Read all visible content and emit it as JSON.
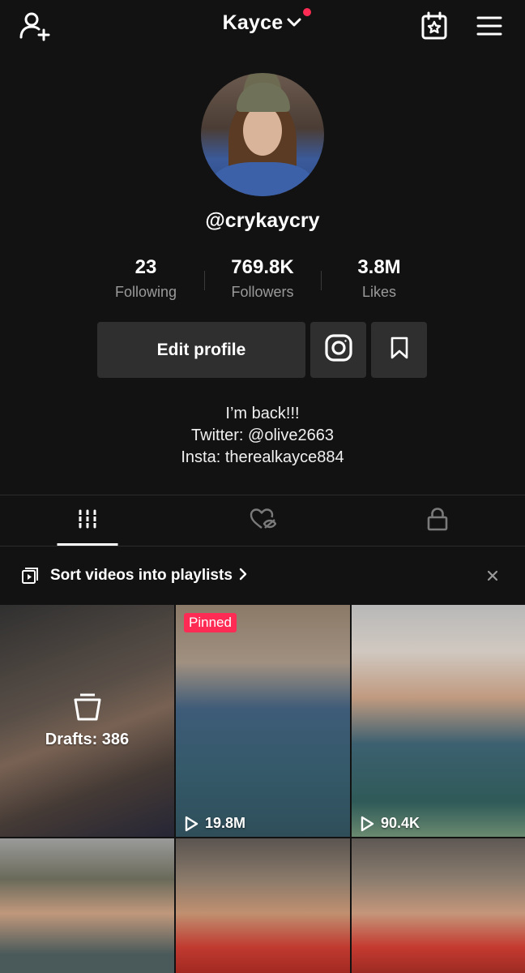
{
  "header": {
    "title": "Kayce"
  },
  "profile": {
    "username": "@crykaycry",
    "stats": [
      {
        "value": "23",
        "label": "Following"
      },
      {
        "value": "769.8K",
        "label": "Followers"
      },
      {
        "value": "3.8M",
        "label": "Likes"
      }
    ],
    "edit_label": "Edit profile",
    "bio": [
      "I’m back!!!",
      "Twitter: @olive2663",
      "Insta: therealkayce884"
    ]
  },
  "banner": {
    "text": "Sort videos into playlists"
  },
  "videos": [
    {
      "drafts_label": "Drafts: 386"
    },
    {
      "badge": "Pinned",
      "views": "19.8M"
    },
    {
      "views": "90.4K"
    }
  ],
  "colors": {
    "background": "#121212",
    "accent": "#fe2c55",
    "button": "#2f2f2f"
  },
  "icons": [
    "add-user-icon",
    "chevron-down-icon",
    "calendar-star-icon",
    "menu-icon",
    "instagram-icon",
    "bookmark-icon",
    "grid-icon",
    "liked-hidden-icon",
    "lock-icon",
    "playlist-icon",
    "close-icon",
    "trash-icon",
    "play-icon"
  ]
}
